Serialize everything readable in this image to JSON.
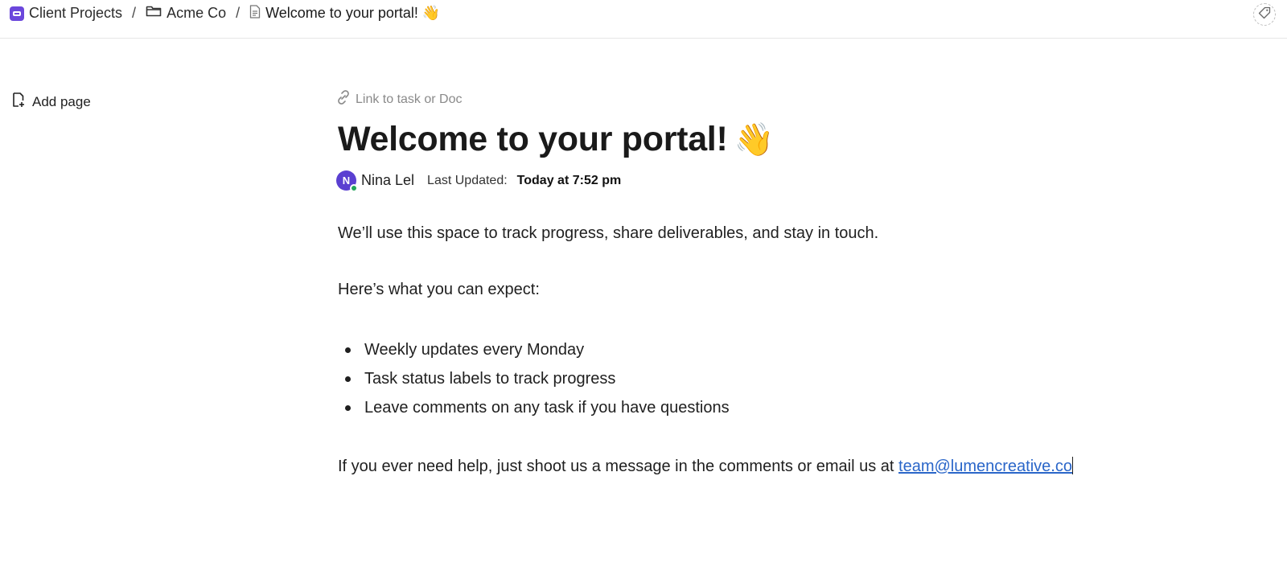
{
  "breadcrumb": {
    "space": "Client Projects",
    "folder": "Acme Co",
    "page": "Welcome to your portal! 👋",
    "separator": "/"
  },
  "sidebar": {
    "add_page": "Add page"
  },
  "doc": {
    "link_task": "Link to task or Doc",
    "title": "Welcome to your portal!",
    "title_emoji": "👋",
    "author": {
      "initial": "N",
      "name": "Nina Lel",
      "status": "online"
    },
    "last_updated_label": "Last Updated:",
    "last_updated_value": "Today at 7:52 pm",
    "paragraph1": "We’ll use this space to track progress, share deliverables, and stay in touch.",
    "paragraph2": "Here’s what you can expect:",
    "bullets": [
      "Weekly updates every Monday",
      "Task status labels to track progress",
      "Leave comments on any task if you have questions"
    ],
    "paragraph3": "If you ever need help, just shoot us a message in the comments or email us at ",
    "email": "team@lumencreative.co"
  },
  "colors": {
    "accent": "#6b47dc",
    "link": "#2a66c9",
    "presence": "#22a55a"
  },
  "icons": {
    "space": "space-icon",
    "folder": "folder-icon",
    "page": "doc-icon",
    "tag": "tag-icon",
    "add_page": "add-page-icon",
    "link": "link-icon"
  }
}
